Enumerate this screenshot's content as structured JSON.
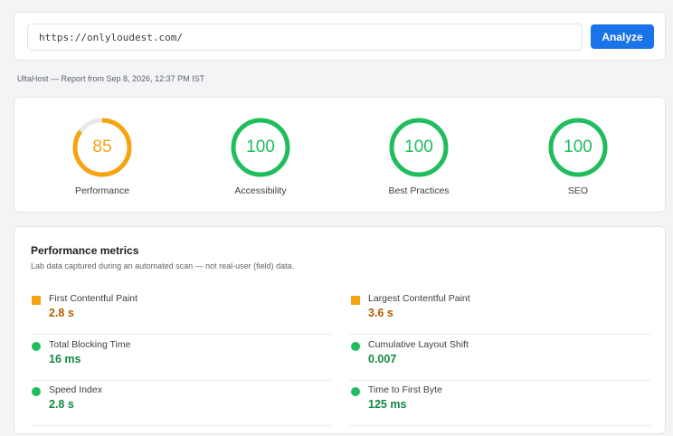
{
  "url_bar": {
    "value": "https://onlyloudest.com/",
    "analyze_label": "Analyze"
  },
  "report_line": "UltaHost — Report from Sep 8, 2026, 12:37 PM IST",
  "colors": {
    "accent": "#1a73e8",
    "score_average": "#f5a30f",
    "score_good": "#1fbd5c"
  },
  "scores": [
    {
      "label": "Performance",
      "value": "85",
      "fraction": 0.85,
      "status": "average"
    },
    {
      "label": "Accessibility",
      "value": "100",
      "fraction": 1.0,
      "status": "good"
    },
    {
      "label": "Best Practices",
      "value": "100",
      "fraction": 1.0,
      "status": "good"
    },
    {
      "label": "SEO",
      "value": "100",
      "fraction": 1.0,
      "status": "good"
    }
  ],
  "metrics": {
    "title": "Performance metrics",
    "subtitle": "Lab data captured during an automated scan — not real-user (field) data.",
    "items": [
      {
        "label": "First Contentful Paint",
        "value": "2.8 s",
        "status": "average"
      },
      {
        "label": "Largest Contentful Paint",
        "value": "3.6 s",
        "status": "average"
      },
      {
        "label": "Total Blocking Time",
        "value": "16 ms",
        "status": "good"
      },
      {
        "label": "Cumulative Layout Shift",
        "value": "0.007",
        "status": "good"
      },
      {
        "label": "Speed Index",
        "value": "2.8 s",
        "status": "good"
      },
      {
        "label": "Time to First Byte",
        "value": "125 ms",
        "status": "good"
      }
    ]
  }
}
